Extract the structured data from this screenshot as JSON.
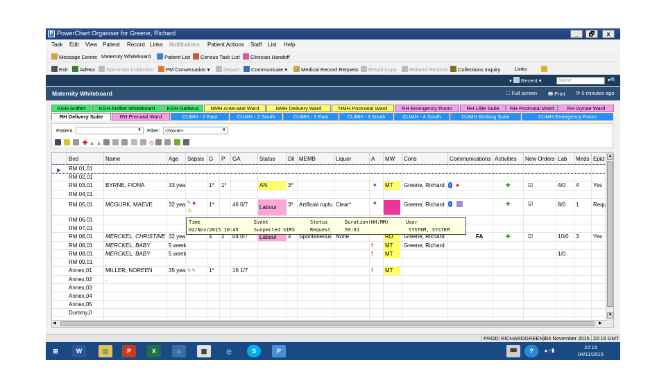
{
  "window": {
    "title": "PowerChart Organiser for  Greene, Richard",
    "min": "_",
    "max": "🗗",
    "close": "x"
  },
  "menu": [
    "Task",
    "Edit",
    "View",
    "Patient",
    "Record",
    "Links",
    "Notifications",
    "Patient Actions",
    "Staff",
    "List",
    "Help"
  ],
  "toolbar1": [
    "Message Centre",
    "Maternity Whiteboard",
    "Patient List",
    "Census Task List",
    "Clinician Handoff"
  ],
  "toolbar2": [
    "Exit",
    "AdHoc",
    "Specimen Collection",
    "PM Conversation",
    "Depart",
    "Communicate",
    "Medical Record Request",
    "Result Copy",
    "Related Records",
    "Collections Inquiry",
    "Links"
  ],
  "recent": "Recent",
  "search_placeholder": "Name",
  "whiteboard": {
    "title": "Maternity Whiteboard",
    "fullscreen": "Full screen",
    "print": "Print",
    "refresh": "0 minutes ago"
  },
  "ward_tabs_row1": [
    {
      "label": "KGH Ardfert",
      "color": "#33ee66"
    },
    {
      "label": "KGH Ardfert Whiteboard",
      "color": "#33ee66"
    },
    {
      "label": "KGH Gallarus",
      "color": "#33ee66"
    },
    {
      "label": "NMH Antenatal Ward",
      "color": "#ffff66"
    },
    {
      "label": "NMH Delivery Ward",
      "color": "#ffff66"
    },
    {
      "label": "NMH Postnatal Ward",
      "color": "#ffff66"
    },
    {
      "label": "RH Emergency Room",
      "color": "#ff99ee"
    },
    {
      "label": "RH Lillie Suite",
      "color": "#ff99ee"
    },
    {
      "label": "RH Postnatal Ward",
      "color": "#ff99ee"
    },
    {
      "label": "RH Gynae Ward",
      "color": "#ff99ee"
    }
  ],
  "ward_tabs_row2": [
    {
      "label": "RH Delivery Suite",
      "color": "#ffffff"
    },
    {
      "label": "RH Prenatal Ward",
      "color": "#ff99ee"
    },
    {
      "label": "CUMH - 2 East",
      "color": "#1e90ff"
    },
    {
      "label": "CUMH - 2 South",
      "color": "#1e90ff"
    },
    {
      "label": "CUMH - 3 East",
      "color": "#1e90ff"
    },
    {
      "label": "CUMH - 3 South",
      "color": "#1e90ff"
    },
    {
      "label": "CUMH - 4 South",
      "color": "#1e90ff"
    },
    {
      "label": "CUMH Birthing Suite",
      "color": "#1e90ff"
    },
    {
      "label": "CUMH Emergency Room",
      "color": "#1e90ff"
    }
  ],
  "filter": {
    "patient_label": "Patient:",
    "filter_label": "Filter:",
    "filter_value": "<None>"
  },
  "columns": [
    "Bed",
    "Name",
    "Age",
    "Sepsis",
    "G",
    "P",
    "GA",
    "Status",
    "Dil",
    "MEMB",
    "Liquor",
    "A",
    "MW",
    "Cons",
    "Communications",
    "Activities",
    "New Orders",
    "Lab",
    "Meds",
    "Epid"
  ],
  "rows": [
    {
      "bed": "RM 01,01"
    },
    {
      "bed": "RM 02,01"
    },
    {
      "bed": "RM 03,01",
      "name": "BYRNE, FIONA",
      "age": "33 yea",
      "g": "1*",
      "p": "1*",
      "status": "AN",
      "dil": "3*",
      "mw": "MT",
      "cons": "Greene, Richard",
      "lab": "4/0",
      "meds": "4",
      "epid": "Yes"
    },
    {
      "bed": "RM 04,01"
    },
    {
      "bed": "RM 05,01",
      "name": "MCGURK, MAEVE",
      "age": "32 yea",
      "g": "1*",
      "ga": "46 0/7",
      "status": "Labour",
      "dil": "3*",
      "memb": "Artificial ruptu",
      "liquor": "Clear*",
      "cons": "Greene, Richard",
      "lab": "8/0",
      "meds": "1",
      "epid": "Requ"
    },
    {
      "bed": "RM 06,01"
    },
    {
      "bed": "RM 07,01"
    },
    {
      "bed": "RM 08,01",
      "name": "MERCKEL, CHRISTINE",
      "age": "32 yea",
      "g": "4",
      "p": "2",
      "ga": "04 0/7",
      "status": "Labour",
      "dil": "4",
      "memb": "Spontaneous",
      "liquor": "None",
      "mw": "RD",
      "cons": "Greene, Richard",
      "comm": "FA",
      "lab": "10/0",
      "meds": "3",
      "epid": "Yes"
    },
    {
      "bed": "RM 08,01",
      "name": "MERCKEL, BABY",
      "age": "5 week",
      "mw": "MT",
      "cons": "Greene, Richard"
    },
    {
      "bed": "RM 08,01",
      "name": "MERCKEL, BABY",
      "age": "5 week",
      "mw": "MT",
      "lab": "1/0"
    },
    {
      "bed": "RM 09,01"
    },
    {
      "bed": "Annex,01",
      "name": "MILLER, NOREEN",
      "age": "35 yea",
      "g": "1*",
      "ga": "16 1/7",
      "mw": "MT"
    },
    {
      "bed": "Annex,02",
      "name": "."
    },
    {
      "bed": "Annex,03"
    },
    {
      "bed": "Annex,04"
    },
    {
      "bed": "Annex,05"
    },
    {
      "bed": "Dummy,0"
    }
  ],
  "tooltip": {
    "headers": [
      "Time",
      "Event",
      "Status",
      "Duration(HH:MM)",
      "User"
    ],
    "values": [
      "02/Nov/2015 10:45",
      "Suspected SIRS",
      "Request",
      "59:31",
      "SYSTEM, SYSTEM"
    ]
  },
  "status": {
    "env": "PROD",
    "user": "RICHARDGREENE",
    "date": "04 November 2015",
    "time": "22:16 GMT"
  },
  "taskbar": {
    "clock_time": "22:16",
    "clock_date": "04/11/2015"
  }
}
